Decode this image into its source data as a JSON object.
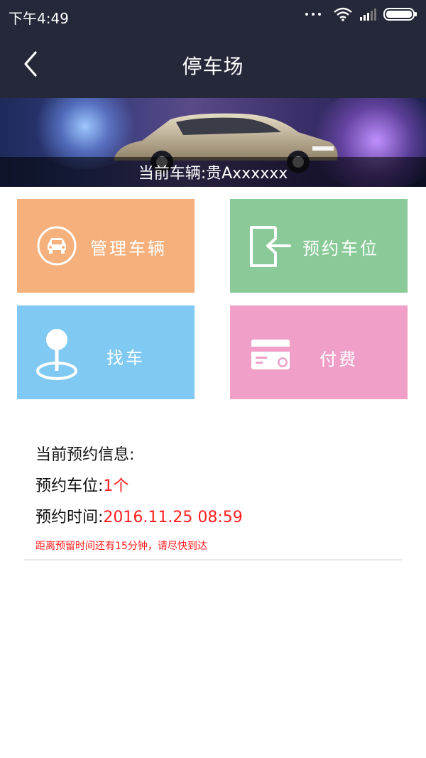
{
  "status_bar": {
    "time": "下午4:49"
  },
  "header": {
    "title": "停车场"
  },
  "banner": {
    "current_vehicle": "当前车辆:贵Axxxxxx"
  },
  "tiles": [
    {
      "label": "管理车辆",
      "icon": "car-icon",
      "color": "#f5b07c"
    },
    {
      "label": "预约车位",
      "icon": "enter-icon",
      "color": "#8ac998"
    },
    {
      "label": "找车",
      "icon": "location-pin-icon",
      "color": "#80c9f2"
    },
    {
      "label": "付费",
      "icon": "payment-card-icon",
      "color": "#f0a0c8"
    }
  ],
  "reservation": {
    "heading": "当前预约信息:",
    "spot_label": "预约车位:",
    "spot_value": "1个",
    "time_label": "预约时间:",
    "time_value": "2016.11.25 08:59",
    "note": "距离预留时间还有15分钟，请尽快到达"
  }
}
